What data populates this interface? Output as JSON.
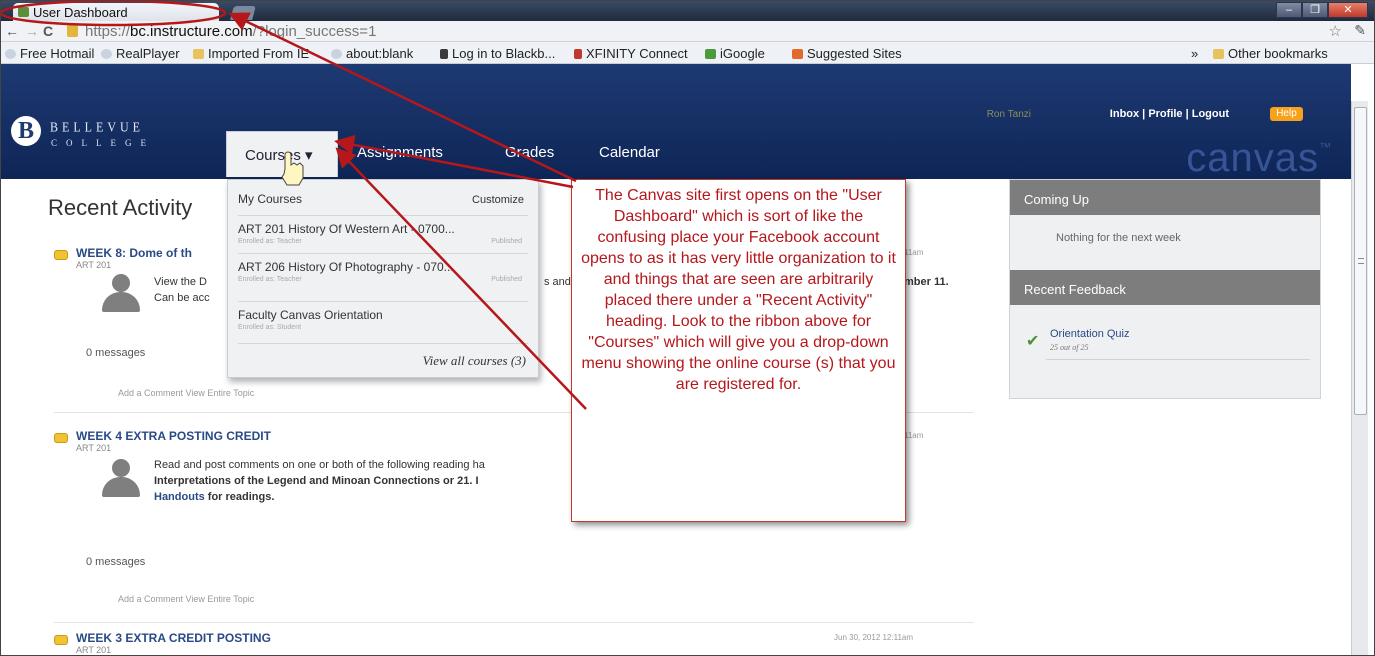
{
  "browser": {
    "tab_title": "User Dashboard",
    "url_scheme": "https://",
    "url_host": "bc.instructure.com",
    "url_path": "/?login_success=1",
    "window_controls": [
      "–",
      "❐",
      "✕"
    ]
  },
  "bookmarks": [
    {
      "label": "Free Hotmail",
      "icon": "globe-icon"
    },
    {
      "label": "RealPlayer",
      "icon": "globe-icon"
    },
    {
      "label": "Imported From IE",
      "icon": "folder-icon"
    },
    {
      "label": "about:blank",
      "icon": "globe-icon"
    },
    {
      "label": "Log in to Blackb...",
      "icon": "blackboard-icon"
    },
    {
      "label": "XFINITY Connect",
      "icon": "xfinity-icon"
    },
    {
      "label": "iGoogle",
      "icon": "igoogle-icon"
    },
    {
      "label": "Suggested Sites",
      "icon": "suggested-icon"
    },
    {
      "label": "Other bookmarks",
      "icon": "folder-icon"
    }
  ],
  "bookmarks_more": "»",
  "header": {
    "logo_letter": "B",
    "logo_line1": "BELLEVUE",
    "logo_line2": "COLLEGE",
    "nav": {
      "courses": "Courses ▾",
      "assignments": "Assignments",
      "grades": "Grades",
      "calendar": "Calendar"
    },
    "user_name": "Ron Tanzi",
    "user_links": "Inbox | Profile | Logout",
    "help": "Help",
    "brand": "canvas",
    "brand_mark": "™"
  },
  "dropdown": {
    "title": "My Courses",
    "customize": "Customize",
    "courses": [
      {
        "name": "ART 201 History Of Western Art - 0700...",
        "role": "Enrolled as: Teacher",
        "status": "Published"
      },
      {
        "name": "ART 206 History Of Photography - 070...",
        "role": "Enrolled as: Teacher",
        "status": "Published"
      },
      {
        "name": "Faculty Canvas Orientation",
        "role": "Enrolled as: Student",
        "status": ""
      }
    ],
    "view_all": "View all courses (3)"
  },
  "main": {
    "title": "Recent Activity",
    "topics": [
      {
        "title": "WEEK 8: Dome of th",
        "course": "ART 201",
        "date": "11am",
        "line1": "View the D",
        "line1_tail": "s and",
        "line1_bold": "mber 11.",
        "line2": "Can be acc",
        "messages": "0 messages",
        "actions": "Add a Comment     View Entire Topic"
      },
      {
        "title": "WEEK 4 EXTRA POSTING CREDIT",
        "course": "ART 201",
        "date": "11am",
        "line1": "Read and post comments on one or both of the following reading ha",
        "line2": "Interpretations of the Legend and Minoan Connections or 21. I",
        "line3_link": "Handouts",
        "line3_rest": " for readings.",
        "messages": "0 messages",
        "actions": "Add a Comment     View Entire Topic"
      },
      {
        "title": "WEEK 3 EXTRA CREDIT POSTING",
        "course": "ART 201",
        "date": "Jun 30, 2012 12:11am"
      }
    ]
  },
  "sidebar": {
    "coming_up": "Coming Up",
    "nothing": "Nothing for the next week",
    "recent_feedback": "Recent Feedback",
    "quiz": "Orientation Quiz",
    "quiz_score": "25 out of 25"
  },
  "callout": {
    "text": "The Canvas site first opens on the \"User Dashboard\" which is sort of like the confusing place your Facebook account opens to as it has very little organization to it and things that are seen are arbitrarily placed there under a \"Recent Activity\" heading. Look to the ribbon above for \"Courses\" which will give you a drop-down menu showing the online course (s) that you are registered for."
  },
  "colors": {
    "header": "#1e3a73",
    "annotation": "#b5171b",
    "link": "#2a4a85",
    "help": "#f6a21a"
  }
}
